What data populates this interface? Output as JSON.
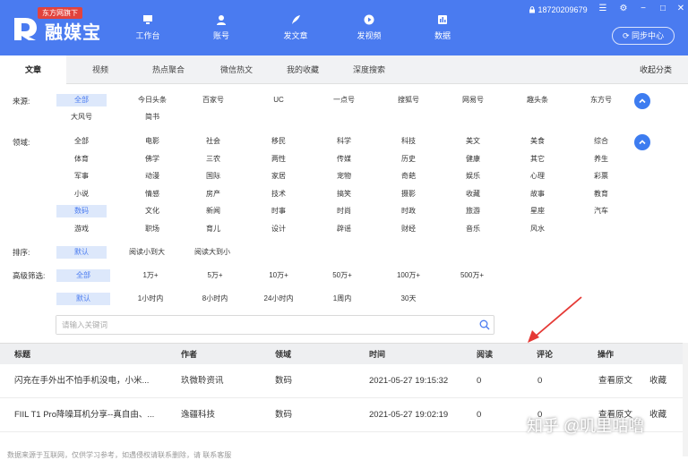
{
  "header": {
    "badge": "东方网旗下",
    "brand": "融媒宝",
    "nav": [
      {
        "label": "工作台",
        "icon": "monitor-icon"
      },
      {
        "label": "账号",
        "icon": "user-icon"
      },
      {
        "label": "发文章",
        "icon": "quill-icon"
      },
      {
        "label": "发视频",
        "icon": "play-icon"
      },
      {
        "label": "数据",
        "icon": "chart-icon"
      }
    ],
    "phone": "18720209679",
    "sync_label": "同步中心"
  },
  "tabs": [
    "文章",
    "视频",
    "热点聚合",
    "微信热文",
    "我的收藏",
    "深度搜索"
  ],
  "active_tab": "文章",
  "collect_label": "收起分类",
  "filters": {
    "source_label": "来源:",
    "sources": [
      "全部",
      "今日头条",
      "百家号",
      "UC",
      "一点号",
      "搜狐号",
      "网易号",
      "趣头条",
      "东方号",
      "大风号",
      "简书"
    ],
    "field_label": "领域:",
    "fields": [
      "全部",
      "电影",
      "社会",
      "移民",
      "科学",
      "科技",
      "美文",
      "美食",
      "综合",
      "体育",
      "佛学",
      "三农",
      "两性",
      "传媒",
      "历史",
      "健康",
      "其它",
      "养生",
      "军事",
      "动漫",
      "国际",
      "家居",
      "宠物",
      "奇葩",
      "娱乐",
      "心理",
      "彩票",
      "小说",
      "情感",
      "房产",
      "技术",
      "搞笑",
      "摄影",
      "收藏",
      "故事",
      "教育",
      "数码",
      "文化",
      "新闻",
      "时事",
      "时尚",
      "时政",
      "旅游",
      "星座",
      "汽车",
      "游戏",
      "职场",
      "育儿",
      "设计",
      "辟谣",
      "财经",
      "音乐",
      "风水"
    ],
    "sort_label": "排序:",
    "sorts": [
      "默认",
      "阅读小到大",
      "阅读大到小"
    ],
    "advanced_label": "高级筛选:",
    "reads": [
      "全部",
      "1万+",
      "5万+",
      "10万+",
      "50万+",
      "100万+",
      "500万+"
    ],
    "times": [
      "默认",
      "1小时内",
      "8小时内",
      "24小时内",
      "1周内",
      "30天"
    ]
  },
  "search": {
    "placeholder": "请输入关键词"
  },
  "table": {
    "headers": [
      "标题",
      "作者",
      "领域",
      "时间",
      "阅读",
      "评论",
      "操作"
    ],
    "rows": [
      {
        "title": "闪充在手外出不怕手机没电，小米...",
        "author": "玖微聆资讯",
        "field": "数码",
        "time": "2021-05-27 19:15:32",
        "reads": "0",
        "comments": "0",
        "view": "查看原文",
        "fav": "收藏"
      },
      {
        "title": "FIIL T1 Pro降噪耳机分享--真自由、...",
        "author": "逸疆科技",
        "field": "数码",
        "time": "2021-05-27 19:02:19",
        "reads": "0",
        "comments": "0",
        "view": "查看原文",
        "fav": "收藏"
      }
    ]
  },
  "footer_text": "数据来源于互联网，仅供学习参考，如遇侵权请联系删除，请 联系客服",
  "watermark": "知乎 @叽里咕噜",
  "colors": {
    "accent": "#4a7bf0",
    "badge": "#e2433d",
    "arrow": "#e53935"
  }
}
